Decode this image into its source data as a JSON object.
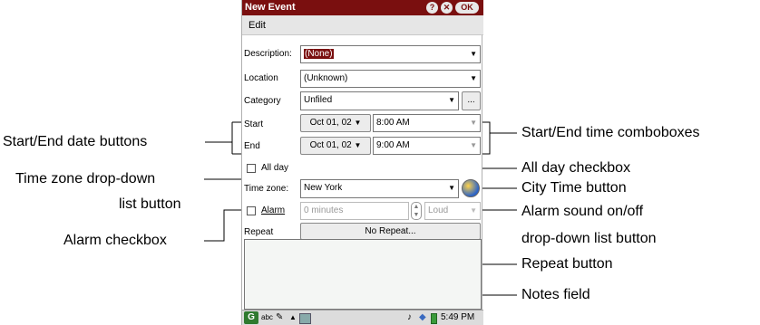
{
  "window": {
    "title": "New Event",
    "ok_label": "OK",
    "help_glyph": "?",
    "close_glyph": "✕"
  },
  "menu": {
    "edit": "Edit"
  },
  "form": {
    "description_label": "Description:",
    "description_value": "(None)",
    "location_label": "Location",
    "location_value": "(Unknown)",
    "category_label": "Category",
    "category_value": "Unfiled",
    "category_more": "...",
    "start_label": "Start",
    "start_date": "Oct 01, 02",
    "start_time": "8:00 AM",
    "end_label": "End",
    "end_date": "Oct 01, 02",
    "end_time": "9:00 AM",
    "allday_label": "All day",
    "timezone_label": "Time zone:",
    "timezone_value": "New York",
    "alarm_label": "Alarm",
    "alarm_value": "0 minutes",
    "alarm_sound": "Loud",
    "repeat_label": "Repeat",
    "repeat_value": "No Repeat..."
  },
  "taskbar": {
    "input_mode": "abc",
    "clock": "5:49 PM"
  },
  "callouts": {
    "start_end_date": "Start/End date buttons",
    "start_end_time": "Start/End time comboboxes",
    "allday": "All day checkbox",
    "tz_line1": "Time zone drop-down",
    "tz_line2": "list button",
    "city_time": "City Time button",
    "alarm_sound_line1": "Alarm sound on/off",
    "alarm_sound_line2": "drop-down list button",
    "alarm_checkbox": "Alarm checkbox",
    "repeat": "Repeat button",
    "notes": "Notes field"
  },
  "colors": {
    "titlebar": "#7a0f0f",
    "highlight": "#7a0f0f"
  }
}
